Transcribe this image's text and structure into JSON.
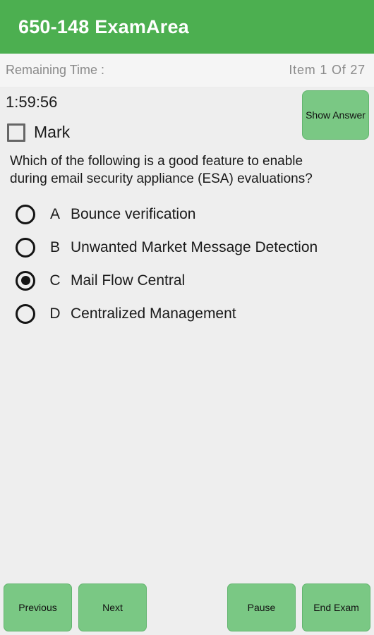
{
  "appbar": {
    "title": "650-148 ExamArea",
    "background": "#4CAF50",
    "text_color": "#FFFFFF"
  },
  "status": {
    "remaining_time_label": "Remaining Time :",
    "item_progress": "Item 1 Of 27"
  },
  "meta": {
    "timer": "1:59:56",
    "mark_label": "Mark",
    "mark_checked": false,
    "show_answer_label": "Show Answer"
  },
  "question": {
    "text": "Which of the following is a good feature to enable during email security appliance (ESA) evaluations?"
  },
  "options": [
    {
      "letter": "A",
      "text": "Bounce verification",
      "selected": false
    },
    {
      "letter": "B",
      "text": "Unwanted Market Message Detection",
      "selected": false
    },
    {
      "letter": "C",
      "text": "Mail Flow Central",
      "selected": true
    },
    {
      "letter": "D",
      "text": "Centralized Management",
      "selected": false
    }
  ],
  "bottombar": {
    "previous_label": "Previous",
    "next_label": "Next",
    "pause_label": "Pause",
    "end_exam_label": "End Exam"
  },
  "colors": {
    "accent_green": "#4CAF50",
    "button_green": "#7AC884",
    "button_border": "#63B56F",
    "page_background": "#EEEEEE",
    "strip_background": "#F5F5F5",
    "muted_text": "#8A8A8A"
  }
}
